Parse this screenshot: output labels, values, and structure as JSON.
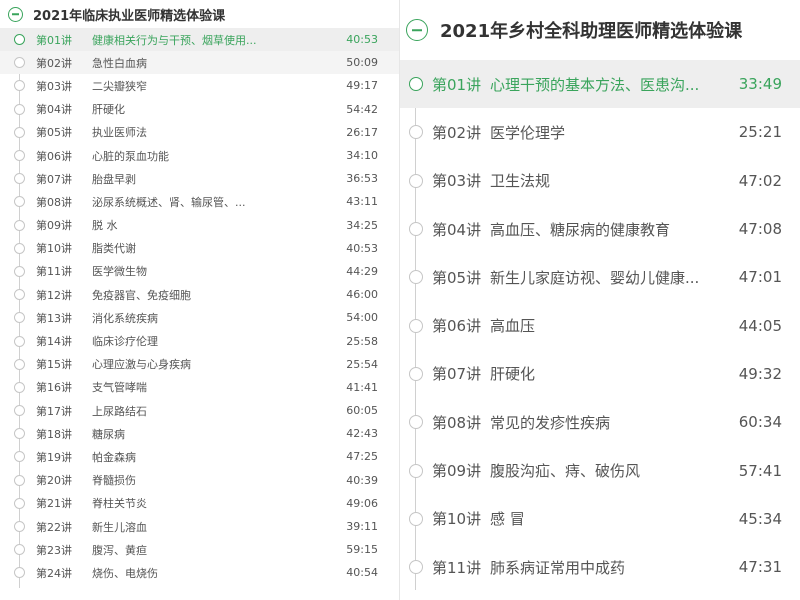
{
  "left": {
    "title": "2021年临床执业医师精选体验课",
    "lessons": [
      {
        "num": "第01讲",
        "title": "健康相关行为与干预、烟草使用...",
        "duration": "40:53"
      },
      {
        "num": "第02讲",
        "title": "急性白血病",
        "duration": "50:09"
      },
      {
        "num": "第03讲",
        "title": "二尖瓣狭窄",
        "duration": "49:17"
      },
      {
        "num": "第04讲",
        "title": "肝硬化",
        "duration": "54:42"
      },
      {
        "num": "第05讲",
        "title": "执业医师法",
        "duration": "26:17"
      },
      {
        "num": "第06讲",
        "title": "心脏的泵血功能",
        "duration": "34:10"
      },
      {
        "num": "第07讲",
        "title": "胎盘早剥",
        "duration": "36:53"
      },
      {
        "num": "第08讲",
        "title": "泌尿系统概述、肾、输尿管、...",
        "duration": "43:11"
      },
      {
        "num": "第09讲",
        "title": "脱 水",
        "duration": "34:25"
      },
      {
        "num": "第10讲",
        "title": "脂类代谢",
        "duration": "40:53"
      },
      {
        "num": "第11讲",
        "title": "医学微生物",
        "duration": "44:29"
      },
      {
        "num": "第12讲",
        "title": "免疫器官、免疫细胞",
        "duration": "46:00"
      },
      {
        "num": "第13讲",
        "title": "消化系统疾病",
        "duration": "54:00"
      },
      {
        "num": "第14讲",
        "title": "临床诊疗伦理",
        "duration": "25:58"
      },
      {
        "num": "第15讲",
        "title": "心理应激与心身疾病",
        "duration": "25:54"
      },
      {
        "num": "第16讲",
        "title": "支气管哮喘",
        "duration": "41:41"
      },
      {
        "num": "第17讲",
        "title": "上尿路结石",
        "duration": "60:05"
      },
      {
        "num": "第18讲",
        "title": "糖尿病",
        "duration": "42:43"
      },
      {
        "num": "第19讲",
        "title": "帕金森病",
        "duration": "47:25"
      },
      {
        "num": "第20讲",
        "title": "脊髓损伤",
        "duration": "40:39"
      },
      {
        "num": "第21讲",
        "title": "脊柱关节炎",
        "duration": "49:06"
      },
      {
        "num": "第22讲",
        "title": "新生儿溶血",
        "duration": "39:11"
      },
      {
        "num": "第23讲",
        "title": "腹泻、黄疸",
        "duration": "59:15"
      },
      {
        "num": "第24讲",
        "title": "烧伤、电烧伤",
        "duration": "40:54"
      }
    ]
  },
  "right": {
    "title": "2021年乡村全科助理医师精选体验课",
    "lessons": [
      {
        "num": "第01讲",
        "title": "心理干预的基本方法、医患沟...",
        "duration": "33:49"
      },
      {
        "num": "第02讲",
        "title": "医学伦理学",
        "duration": "25:21"
      },
      {
        "num": "第03讲",
        "title": "卫生法规",
        "duration": "47:02"
      },
      {
        "num": "第04讲",
        "title": "高血压、糖尿病的健康教育",
        "duration": "47:08"
      },
      {
        "num": "第05讲",
        "title": "新生儿家庭访视、婴幼儿健康...",
        "duration": "47:01"
      },
      {
        "num": "第06讲",
        "title": "高血压",
        "duration": "44:05"
      },
      {
        "num": "第07讲",
        "title": "肝硬化",
        "duration": "49:32"
      },
      {
        "num": "第08讲",
        "title": "常见的发疹性疾病",
        "duration": "60:34"
      },
      {
        "num": "第09讲",
        "title": "腹股沟疝、痔、破伤风",
        "duration": "57:41"
      },
      {
        "num": "第10讲",
        "title": "感 冒",
        "duration": "45:34"
      },
      {
        "num": "第11讲",
        "title": "肺系病证常用中成药",
        "duration": "47:31"
      }
    ]
  },
  "icons": {
    "collapse": "collapse-circle-minus-icon",
    "node": "timeline-node-icon"
  },
  "colors": {
    "accent": "#3aa45c",
    "text": "#555555",
    "active_bg": "#eeeeee"
  }
}
